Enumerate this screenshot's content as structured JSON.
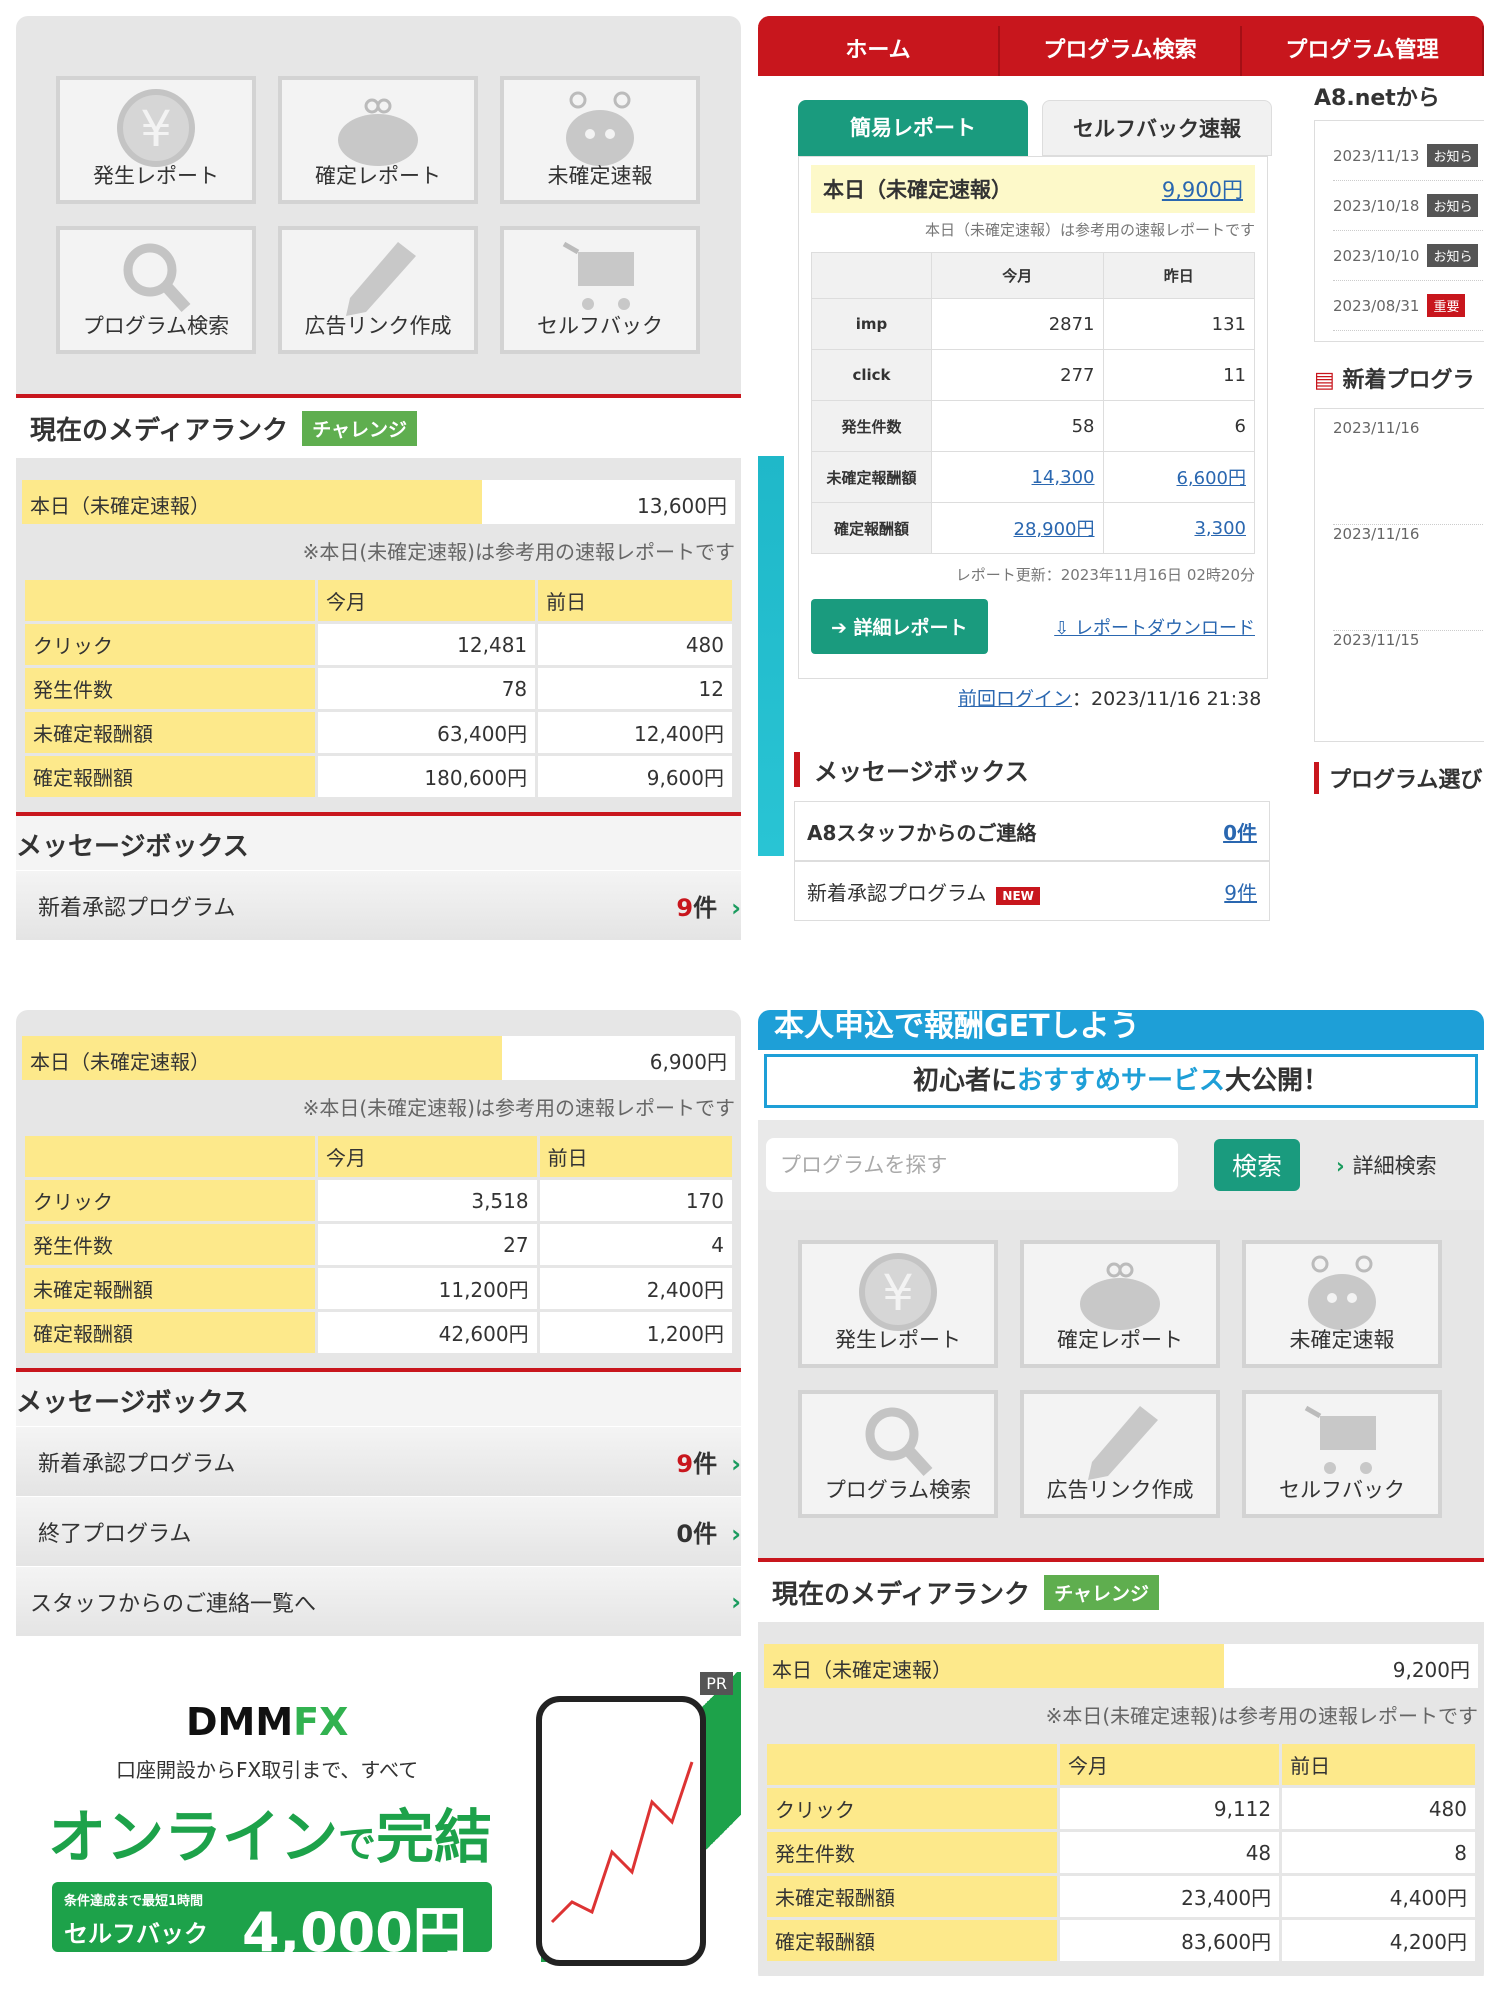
{
  "menu_tiles": [
    {
      "label": "発生レポート",
      "icon": "yen-icon"
    },
    {
      "label": "確定レポート",
      "icon": "purse-icon"
    },
    {
      "label": "未確定速報",
      "icon": "mascot-icon"
    },
    {
      "label": "プログラム検索",
      "icon": "magnifier-icon"
    },
    {
      "label": "広告リンク作成",
      "icon": "pencil-icon"
    },
    {
      "label": "セルフバック",
      "icon": "cart-icon"
    }
  ],
  "media_rank": {
    "title": "現在のメディアランク",
    "badge": "チャレンジ"
  },
  "report_labels": {
    "today": "本日（未確定速報）",
    "note": "※本日(未確定速報)は参考用の速報レポートです",
    "this_month": "今月",
    "prev_day": "前日",
    "rows": [
      "クリック",
      "発生件数",
      "未確定報酬額",
      "確定報酬額"
    ]
  },
  "panel1": {
    "today_value": "13,600円",
    "values": [
      [
        "12,481",
        "480"
      ],
      [
        "78",
        "12"
      ],
      [
        "63,400円",
        "12,400円"
      ],
      [
        "180,600円",
        "9,600円"
      ]
    ]
  },
  "panel3": {
    "today_value": "6,900円",
    "values": [
      [
        "3,518",
        "170"
      ],
      [
        "27",
        "4"
      ],
      [
        "11,200円",
        "2,400円"
      ],
      [
        "42,600円",
        "1,200円"
      ]
    ]
  },
  "panel4": {
    "today_value": "9,200円",
    "values": [
      [
        "9,112",
        "480"
      ],
      [
        "48",
        "8"
      ],
      [
        "23,400円",
        "4,400円"
      ],
      [
        "83,600円",
        "4,200円"
      ]
    ]
  },
  "message_box": {
    "title": "メッセージボックス",
    "new_programs": "新着承認プログラム",
    "new_count_num": "9",
    "count_unit": "件",
    "ended_programs": "終了プログラム",
    "ended_count_num": "0",
    "staff_link": "スタッフからのご連絡一覧へ"
  },
  "a8": {
    "nav": [
      "ホーム",
      "プログラム検索",
      "プログラム管理"
    ],
    "tabs": [
      "簡易レポート",
      "セルフバック速報"
    ],
    "today_label": "本日（未確定速報）",
    "today_value": "9,900円",
    "note": "本日（未確定速報）は参考用の速報レポートです",
    "col_month": "今月",
    "col_yesterday": "昨日",
    "rows": [
      {
        "label": "imp",
        "m": "2871",
        "y": "131"
      },
      {
        "label": "click",
        "m": "277",
        "y": "11"
      },
      {
        "label": "発生件数",
        "m": "58",
        "y": "6"
      },
      {
        "label": "未確定報酬額",
        "m": "14,300",
        "y": "6,600円"
      },
      {
        "label": "確定報酬額",
        "m": "28,900円",
        "y": "3,300"
      }
    ],
    "updated": "レポート更新：2023年11月16日 02時20分",
    "detail_button": "詳細レポート",
    "download": "レポートダウンロード",
    "last_login_label": "前回ログイン",
    "last_login": "：2023/11/16 21:38",
    "msg_title": "メッセージボックス",
    "staff_msg": "A8スタッフからのご連絡",
    "staff_count": "0件",
    "new_prog": "新着承認プログラム",
    "new_tag": "NEW",
    "new_count": "9件",
    "side_title": "A8.netから",
    "news": [
      {
        "date": "2023/11/13",
        "tag": "お知ら"
      },
      {
        "date": "2023/10/18",
        "tag": "お知ら"
      },
      {
        "date": "2023/10/10",
        "tag": "お知ら"
      },
      {
        "date": "2023/08/31",
        "tag": "重要"
      }
    ],
    "new_prog_title": "新着プログラ",
    "new_dates": [
      "2023/11/16",
      "2023/11/16",
      "2023/11/15"
    ],
    "prog_select": "プログラム選び"
  },
  "banner": {
    "line1": "本人申込で報酬GETしよう",
    "line2a": "初心者に",
    "line2b": "おすすめサービス",
    "line2c": "大公開！"
  },
  "search": {
    "placeholder": "プログラムを探す",
    "button": "検索",
    "detail": "詳細検索"
  },
  "ad": {
    "pr": "PR",
    "brand_a": "DMM",
    "brand_b": "FX",
    "line1": "口座開設からFX取引まで、すべて",
    "line2a": "オンライン",
    "line2b": "で",
    "line2c": "完結",
    "cond": "条件達成まで最短1時間",
    "selfback": "セルフバック",
    "reward": "4,000円"
  },
  "colors": {
    "accent_red": "#c8161d",
    "a8_green": "#1a9b7e",
    "highlight_yellow": "#fde98b"
  }
}
